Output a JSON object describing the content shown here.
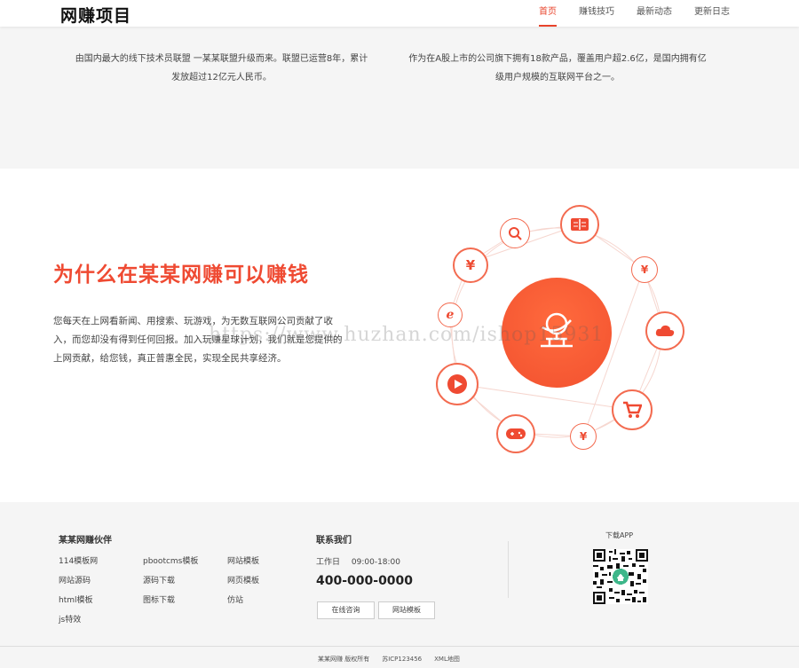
{
  "header": {
    "logo": "网赚项目",
    "nav": [
      {
        "label": "首页",
        "active": true
      },
      {
        "label": "赚钱技巧",
        "active": false
      },
      {
        "label": "最新动态",
        "active": false
      },
      {
        "label": "更新日志",
        "active": false
      }
    ]
  },
  "intro": {
    "left_text": "由国内最大的线下技术员联盟 一某某联盟升级而来。联盟已运营8年，累计发放超过12亿元人民币。",
    "right_text": "作为在A股上市的公司旗下拥有18款产品，覆盖用户超2.6亿，是国内拥有亿级用户规模的互联网平台之一。"
  },
  "why": {
    "title": "为什么在某某网赚可以赚钱",
    "description": "您每天在上网看新闻、用搜索、玩游戏，为无数互联网公司贡献了收入，而您却没有得到任何回报。加入玩赚星球计划，我们就是您提供的上网贡献，给您钱，真正普惠全民，实现全民共享经济。"
  },
  "diagram": {
    "icons": [
      "book-icon",
      "search-icon",
      "yuan-icon",
      "yuan-icon",
      "ie-browser-icon",
      "cloud-icon",
      "play-icon",
      "cart-icon",
      "gamepad-icon",
      "yuan-icon",
      "planet-icon"
    ],
    "accent": "#ef4a32"
  },
  "watermark": "https://www.huzhan.com/ishop15931",
  "footer": {
    "partners_title": "某某网赚伙伴",
    "partner_links": [
      "114模板网",
      "pbootcms模板",
      "网站模板",
      "网站源码",
      "源码下载",
      "网页模板",
      "html模板",
      "图标下载",
      "仿站",
      "js特效"
    ],
    "contact_title": "联系我们",
    "work_label": "工作日",
    "work_hours": "09:00-18:00",
    "phone": "400-000-0000",
    "buttons": [
      "在线咨询",
      "网站模板"
    ],
    "download_label": "下载APP",
    "copyright": [
      "某某网赚 版权所有",
      "苏ICP123456",
      "XML地图"
    ]
  }
}
